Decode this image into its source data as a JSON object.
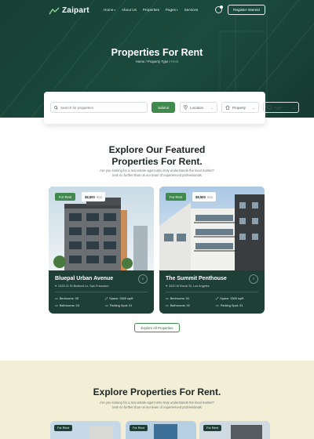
{
  "brand": {
    "name": "Zaipart"
  },
  "nav": {
    "items": [
      {
        "label": "Home",
        "has_dropdown": true
      },
      {
        "label": "About Us",
        "has_dropdown": false
      },
      {
        "label": "Properties",
        "has_dropdown": false
      },
      {
        "label": "Pages",
        "has_dropdown": true
      },
      {
        "label": "Services",
        "has_dropdown": false
      }
    ],
    "register_label": "Register Interest"
  },
  "hero": {
    "title": "Properties For Rent",
    "breadcrumb": {
      "home": "Home",
      "middle": "Property Type",
      "current": "Rent"
    }
  },
  "search": {
    "placeholder": "Search for properties",
    "submit_label": "Submit",
    "location_label": "Location",
    "property_label": "Property",
    "type_label": "Type"
  },
  "featured": {
    "title_line1": "Explore Our Featured",
    "title_line2": "Properties For Rent.",
    "desc_line1": "Are you looking for a real estate agent who truly understands the local market?",
    "desc_line2": "look no further than us our team of experienced professionals",
    "cards": [
      {
        "tag": "For Rent",
        "price": "$8,500",
        "per": "/mo",
        "name": "Bluepal Urban Avenue",
        "address": "2325 21 St Bedford Ln, San Francisco",
        "bedrooms": "Bedrooms: 05",
        "space": "Space: 3300 sq/ft",
        "bathrooms": "Bathrooms: 03",
        "parking": "Parking Spot: 01"
      },
      {
        "tag": "For Rent",
        "price": "$8,500",
        "per": "/mo",
        "name": "The Summit Penthouse",
        "address": "3310 W Brook St, Los Angeles",
        "bedrooms": "Bedrooms: 04",
        "space": "Space: 3300 sq/ft",
        "bathrooms": "Bathrooms: 02",
        "parking": "Parking Spot: 01"
      }
    ],
    "explore_label": "Explore All Properties"
  },
  "rent_section": {
    "title": "Explore Properties For Rent.",
    "desc_line1": "Are you looking for a real estate agent who truly understands the local market?",
    "desc_line2": "look no further than us our team of experienced professionals",
    "cards": [
      {
        "tag": "For Rent"
      },
      {
        "tag": "For Rent"
      },
      {
        "tag": "For Rent"
      }
    ]
  },
  "colors": {
    "primary": "#1b4b3e",
    "accent": "#3f8a4c",
    "cream": "#f2efd6",
    "card": "#1d3f35"
  }
}
